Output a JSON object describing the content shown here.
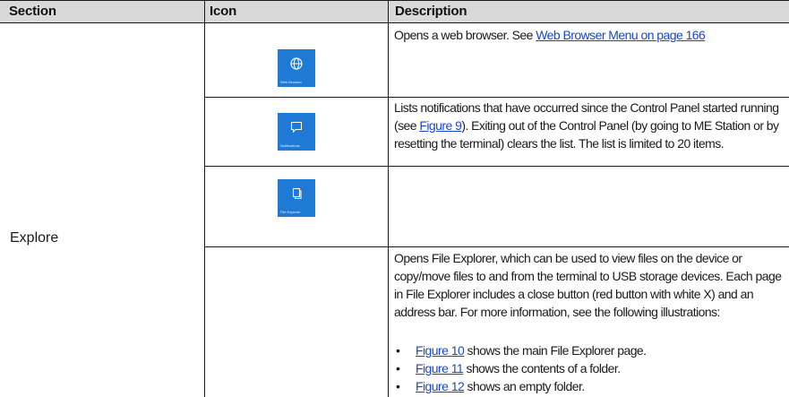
{
  "table": {
    "headers": {
      "section": "Section",
      "icon": "Icon",
      "description": "Description"
    },
    "section_label": "Explore",
    "rows": [
      {
        "icon": {
          "name": "globe-icon",
          "caption": "Web Browser"
        },
        "text_before": "Opens a web browser. See ",
        "link": "Web Browser Menu on page 166",
        "text_after": ""
      },
      {
        "icon": {
          "name": "speech-bubble-icon",
          "caption": "Notifications"
        },
        "text_before": "Lists notifications that have occurred since the Control Panel started running (see ",
        "link": "Figure 9",
        "text_after": "). Exiting out of the Control Panel (by going to ME Station or by resetting the terminal) clears the list. The list is limited to 20 items."
      },
      {
        "icon": {
          "name": "documents-icon",
          "caption": "File Explorer"
        },
        "text": "Opens File Explorer, which can be used to view files on the device or copy/move files to and from the terminal to USB storage devices. Each page in File Explorer includes a close button (red button with white X) and an address bar. For more information, see the following illustrations:",
        "bullets": [
          {
            "link": "Figure 10",
            "text": " shows the main File Explorer page."
          },
          {
            "link": "Figure 11",
            "text": " shows the contents of a folder."
          },
          {
            "link": "Figure 12",
            "text": " shows an empty folder."
          }
        ]
      }
    ]
  },
  "colors": {
    "tile": "#1f7ad6",
    "link": "#1a47c9",
    "header_bg": "#d9d9d9"
  }
}
